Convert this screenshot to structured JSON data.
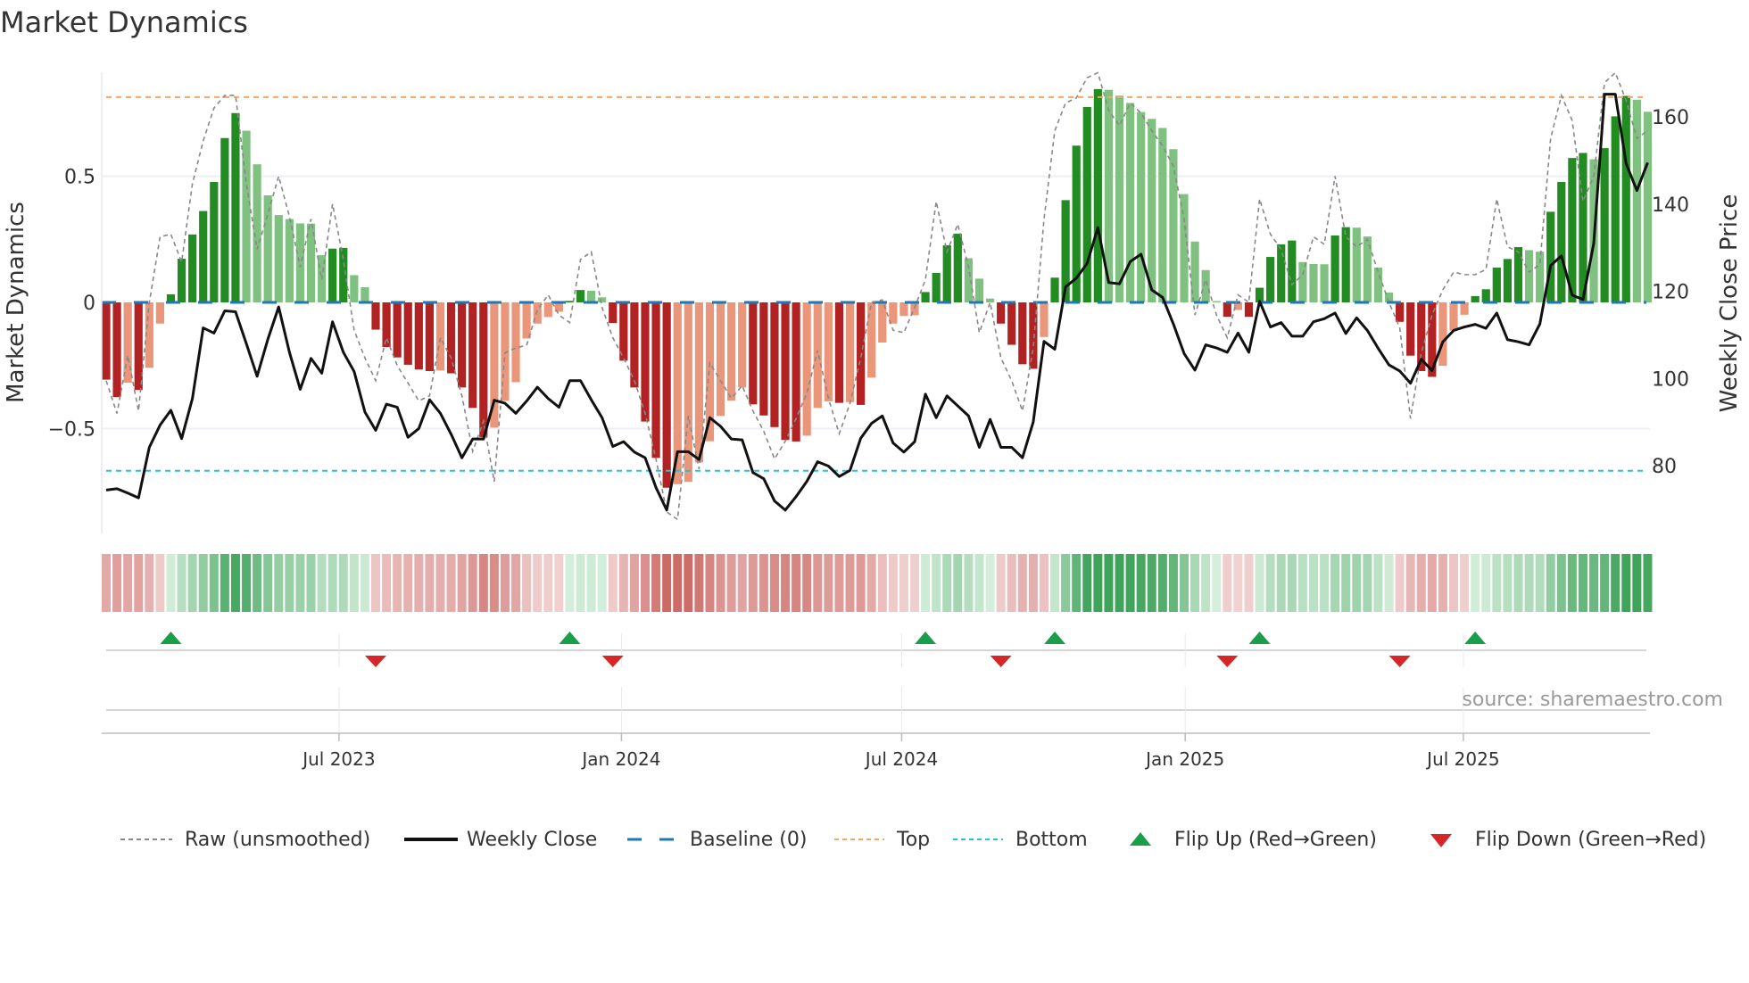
{
  "title": "Market Dynamics",
  "source": "source: sharemaestro.com",
  "chart_data": {
    "type": "bar",
    "title": "Market Dynamics",
    "ylabel": "Market Dynamics",
    "y2label": "Weekly Close Price",
    "ylim": [
      -0.95,
      0.97
    ],
    "y2lim": [
      57,
      178
    ],
    "yticks": [
      {
        "v": 0.5,
        "label": "0.5"
      },
      {
        "v": 0,
        "label": "0"
      },
      {
        "v": -0.5,
        "label": "−0.5"
      }
    ],
    "y2ticks": [
      {
        "v": 160,
        "label": "160"
      },
      {
        "v": 140,
        "label": "140"
      },
      {
        "v": 120,
        "label": "120"
      },
      {
        "v": 100,
        "label": "100"
      },
      {
        "v": 80,
        "label": "80"
      }
    ],
    "xticks": [
      {
        "week": 21.6,
        "label": "Jul 2023"
      },
      {
        "week": 47.8,
        "label": "Jan 2024"
      },
      {
        "week": 73.8,
        "label": "Jul 2024"
      },
      {
        "week": 100.1,
        "label": "Jan 2025"
      },
      {
        "week": 125.9,
        "label": "Jul 2025"
      }
    ],
    "top": 0.813,
    "bottom": -0.667,
    "baseline": 0,
    "values": [
      -0.306,
      -0.375,
      -0.318,
      -0.347,
      -0.259,
      -0.084,
      0.032,
      0.173,
      0.269,
      0.362,
      0.477,
      0.651,
      0.75,
      0.68,
      0.547,
      0.424,
      0.346,
      0.33,
      0.313,
      0.312,
      0.187,
      0.213,
      0.216,
      0.108,
      0.06,
      -0.108,
      -0.177,
      -0.218,
      -0.247,
      -0.266,
      -0.272,
      -0.27,
      -0.281,
      -0.337,
      -0.418,
      -0.534,
      -0.496,
      -0.39,
      -0.316,
      -0.143,
      -0.084,
      -0.058,
      -0.037,
      0.006,
      0.049,
      0.046,
      0.02,
      -0.082,
      -0.231,
      -0.337,
      -0.472,
      -0.616,
      -0.734,
      -0.72,
      -0.711,
      -0.634,
      -0.55,
      -0.45,
      -0.389,
      -0.337,
      -0.404,
      -0.448,
      -0.494,
      -0.545,
      -0.551,
      -0.528,
      -0.418,
      -0.392,
      -0.398,
      -0.395,
      -0.406,
      -0.298,
      -0.159,
      -0.084,
      -0.054,
      -0.051,
      0.041,
      0.117,
      0.226,
      0.272,
      0.175,
      0.094,
      0.015,
      -0.084,
      -0.168,
      -0.245,
      -0.263,
      -0.137,
      0.098,
      0.405,
      0.621,
      0.774,
      0.845,
      0.842,
      0.819,
      0.79,
      0.754,
      0.727,
      0.691,
      0.607,
      0.429,
      0.241,
      0.128,
      0.005,
      -0.057,
      -0.03,
      -0.057,
      0.058,
      0.18,
      0.23,
      0.245,
      0.16,
      0.152,
      0.151,
      0.265,
      0.298,
      0.296,
      0.261,
      0.138,
      0.039,
      -0.077,
      -0.211,
      -0.272,
      -0.295,
      -0.251,
      -0.112,
      -0.049,
      0.025,
      0.052,
      0.138,
      0.172,
      0.219,
      0.207,
      0.201,
      0.359,
      0.477,
      0.572,
      0.592,
      0.567,
      0.611,
      0.737,
      0.818,
      0.803,
      0.755
    ],
    "raw": [
      -0.31,
      -0.44,
      -0.21,
      -0.43,
      0,
      0.26,
      0.27,
      0.16,
      0.47,
      0.64,
      0.77,
      0.82,
      0.82,
      0.47,
      0.21,
      0.35,
      0.5,
      0.34,
      0.14,
      0.33,
      0.09,
      0.39,
      0.17,
      -0.11,
      -0.22,
      -0.31,
      -0.14,
      -0.25,
      -0.32,
      -0.39,
      -0.37,
      -0.14,
      -0.22,
      -0.37,
      -0.59,
      -0.47,
      -0.71,
      -0.2,
      -0.18,
      -0.17,
      -0.03,
      0.03,
      -0.05,
      -0.08,
      0.17,
      0.2,
      -0.02,
      -0.14,
      -0.22,
      -0.31,
      -0.44,
      -0.62,
      -0.83,
      -0.86,
      -0.45,
      -0.66,
      -0.24,
      -0.31,
      -0.38,
      -0.33,
      -0.43,
      -0.51,
      -0.62,
      -0.55,
      -0.46,
      -0.36,
      -0.19,
      -0.38,
      -0.52,
      -0.4,
      -0.22,
      0,
      0.01,
      -0.11,
      -0.12,
      -0.02,
      0.09,
      0.4,
      0.2,
      0.31,
      0.14,
      -0.12,
      0,
      -0.22,
      -0.31,
      -0.43,
      -0.18,
      0.33,
      0.68,
      0.79,
      0.81,
      0.89,
      0.91,
      0.76,
      0.7,
      0.79,
      0.75,
      0.68,
      0.62,
      0.54,
      0.33,
      -0.05,
      0.09,
      -0.05,
      -0.14,
      0.03,
      0,
      0.41,
      0.27,
      0.21,
      0.07,
      0.11,
      0.26,
      0.23,
      0.5,
      0.26,
      0.22,
      0.25,
      0.12,
      0,
      -0.1,
      -0.46,
      -0.2,
      -0.05,
      0.05,
      0.12,
      0.11,
      0.11,
      0.13,
      0.41,
      0.22,
      0.2,
      0.12,
      0.15,
      0.65,
      0.82,
      0.72,
      0.4,
      0.5,
      0.87,
      0.91,
      0.8,
      0.65,
      0.68
    ],
    "close": [
      74.4,
      74.7,
      73.7,
      72.6,
      84.2,
      89.3,
      92.7,
      86.2,
      95.4,
      111.6,
      110.4,
      115.5,
      115.3,
      108,
      100.5,
      109,
      116.4,
      106,
      97.5,
      104.6,
      101.2,
      113,
      106,
      101.6,
      92.3,
      88.1,
      94.1,
      93.4,
      86.5,
      88.5,
      95.1,
      92,
      87.2,
      81.8,
      86.1,
      86.1,
      95,
      94.3,
      92,
      94.8,
      98,
      95.4,
      93.4,
      99.5,
      99.5,
      95.1,
      91,
      84.4,
      85.5,
      83.1,
      81.8,
      75,
      69.8,
      83.2,
      83.2,
      81.4,
      91,
      89,
      86.1,
      85.9,
      78.4,
      77,
      71.9,
      69.8,
      72.9,
      76.4,
      80.9,
      79.9,
      77.5,
      78.9,
      86.3,
      89.7,
      91.4,
      85.2,
      83.1,
      85.5,
      96.4,
      91,
      96,
      93.7,
      91.4,
      84.2,
      90.6,
      84.2,
      84.2,
      81.8,
      90,
      108.5,
      106.7,
      121,
      123,
      126.4,
      134.6,
      122,
      121.7,
      126.8,
      128.5,
      120.3,
      118.6,
      112.5,
      105.7,
      101.9,
      107.7,
      107,
      106,
      110.4,
      106,
      117.7,
      111.8,
      112.8,
      109.7,
      109.7,
      113,
      113.7,
      115,
      110.3,
      113.9,
      111,
      106.9,
      103.1,
      101.7,
      98.9,
      104.4,
      101.8,
      108.4,
      111,
      111.8,
      112.4,
      111.5,
      115,
      108.9,
      108.4,
      107.7,
      112.5,
      125.9,
      128.1,
      119.1,
      118.1,
      131,
      165.2,
      165.2,
      149.3,
      143.1,
      149.5
    ],
    "flip_up": [
      6,
      43,
      76,
      88,
      107,
      127
    ],
    "flip_down": [
      25,
      47,
      83,
      104,
      120
    ],
    "legend": [
      {
        "key": "raw",
        "label": "Raw (unsmoothed)"
      },
      {
        "key": "close",
        "label": "Weekly Close"
      },
      {
        "key": "baseline",
        "label": "Baseline (0)"
      },
      {
        "key": "top",
        "label": "Top"
      },
      {
        "key": "bottom",
        "label": "Bottom"
      },
      {
        "key": "flip_up",
        "label": "Flip Up (Red→Green)"
      },
      {
        "key": "flip_down",
        "label": "Flip Down (Green→Red)"
      }
    ],
    "legend_position": "bottom",
    "colors": {
      "pos_strong": "#228b22",
      "pos_weak": "#80c080",
      "neg_strong": "#b22222",
      "neg_weak": "#e9967a",
      "close": "#111111",
      "raw": "#888888",
      "baseline": "#1f77b4",
      "top": "#f0a868",
      "bottom": "#22c4dc",
      "flip_up": "#1a9e4a",
      "flip_down": "#d62728"
    }
  }
}
